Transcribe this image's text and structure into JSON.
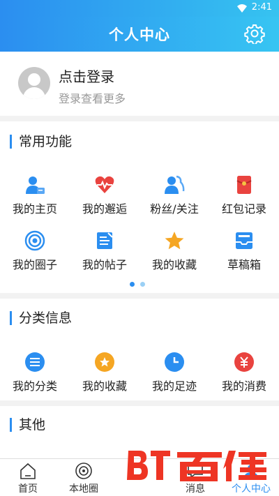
{
  "status_bar": {
    "time": "2:41"
  },
  "header": {
    "title": "个人中心"
  },
  "login": {
    "title": "点击登录",
    "subtitle": "登录查看更多"
  },
  "common": {
    "title": "常用功能",
    "items": [
      {
        "label": "我的主页",
        "icon": "user-card-icon",
        "color": "#2b8ef0"
      },
      {
        "label": "我的邂逅",
        "icon": "heartbeat-icon",
        "color": "#e9433f"
      },
      {
        "label": "粉丝/关注",
        "icon": "fans-icon",
        "color": "#2b8ef0"
      },
      {
        "label": "红包记录",
        "icon": "red-envelope-icon",
        "color": "#e9433f"
      },
      {
        "label": "我的圈子",
        "icon": "circle-target-icon",
        "color": "#2b8ef0"
      },
      {
        "label": "我的帖子",
        "icon": "post-edit-icon",
        "color": "#2b8ef0"
      },
      {
        "label": "我的收藏",
        "icon": "star-icon",
        "color": "#f5a623"
      },
      {
        "label": "草稿箱",
        "icon": "draft-box-icon",
        "color": "#2b8ef0"
      }
    ],
    "page_dots": {
      "active": 1,
      "count": 2
    }
  },
  "category": {
    "title": "分类信息",
    "items": [
      {
        "label": "我的分类",
        "icon": "category-list-icon",
        "color": "#2b8ef0"
      },
      {
        "label": "我的收藏",
        "icon": "favorite-badge-icon",
        "color": "#f5a623"
      },
      {
        "label": "我的足迹",
        "icon": "clock-icon",
        "color": "#2b8ef0"
      },
      {
        "label": "我的消费",
        "icon": "yuan-icon",
        "color": "#e9433f"
      }
    ]
  },
  "other": {
    "title": "其他"
  },
  "tabbar": {
    "items": [
      {
        "label": "首页",
        "icon": "home-icon"
      },
      {
        "label": "本地圈",
        "icon": "local-circle-icon"
      },
      {
        "label": "",
        "icon": "publish-icon"
      },
      {
        "label": "消息",
        "icon": "message-icon"
      },
      {
        "label": "个人中心",
        "icon": "profile-icon"
      }
    ]
  },
  "watermark": {
    "text": "百佳"
  }
}
